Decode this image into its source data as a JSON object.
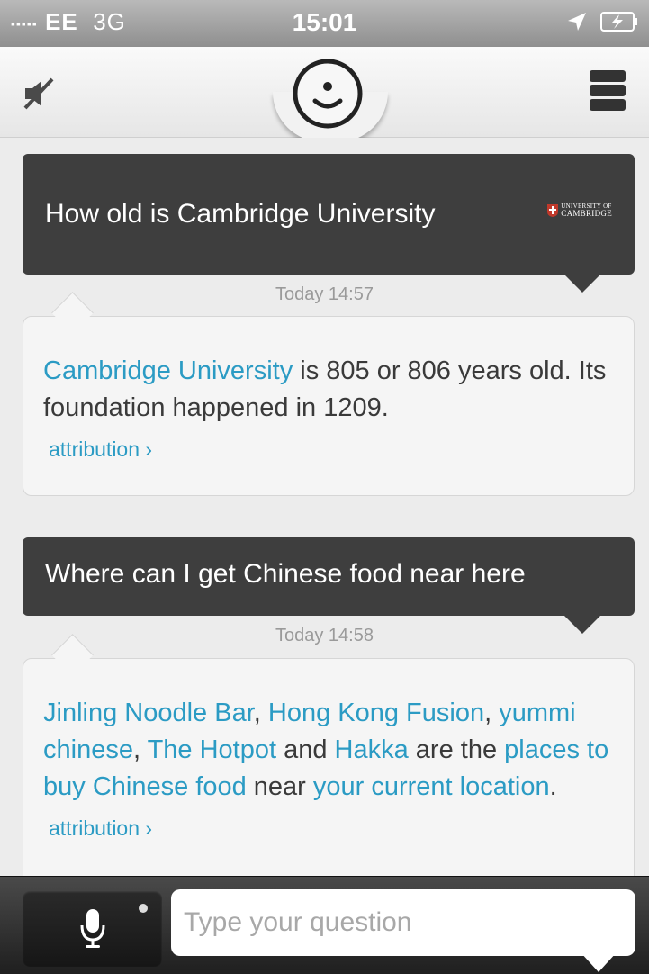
{
  "status_bar": {
    "carrier": "EE",
    "network": "3G",
    "time": "15:01"
  },
  "conversation": [
    {
      "question": "How old is Cambridge University",
      "source_logo_line1": "UNIVERSITY OF",
      "source_logo_line2": "CAMBRIDGE",
      "timestamp": "Today 14:57",
      "answer": {
        "link1": "Cambridge University",
        "text1": " is 805 or 806 years old. Its foundation happened in 1209."
      },
      "attribution_label": "attribution"
    },
    {
      "question": "Where can I get Chinese food near here",
      "timestamp": "Today 14:58",
      "answer": {
        "link1": "Jinling Noodle Bar",
        "sep1": ", ",
        "link2": "Hong Kong Fusion",
        "sep2": ",",
        "link3": "yummi chinese",
        "sep3": ", ",
        "link4": "The Hotpot",
        "sep4": " and ",
        "link5": "Hakka",
        "text_mid": " are the ",
        "link6": "places to buy Chinese food",
        "text_near": " near ",
        "link7": "your current location",
        "text_end": "."
      },
      "attribution_label": "attribution"
    }
  ],
  "input": {
    "placeholder": "Type your question",
    "value": ""
  },
  "colors": {
    "link": "#2b9bc4",
    "question_bubble": "#3e3e3e",
    "answer_bubble": "#f5f5f5"
  },
  "icons": {
    "mute": "speaker-muted-icon",
    "menu": "stacked-menu-icon",
    "logo": "smiley-face-icon",
    "mic": "microphone-icon",
    "location": "location-arrow-icon",
    "battery": "battery-charging-icon"
  }
}
